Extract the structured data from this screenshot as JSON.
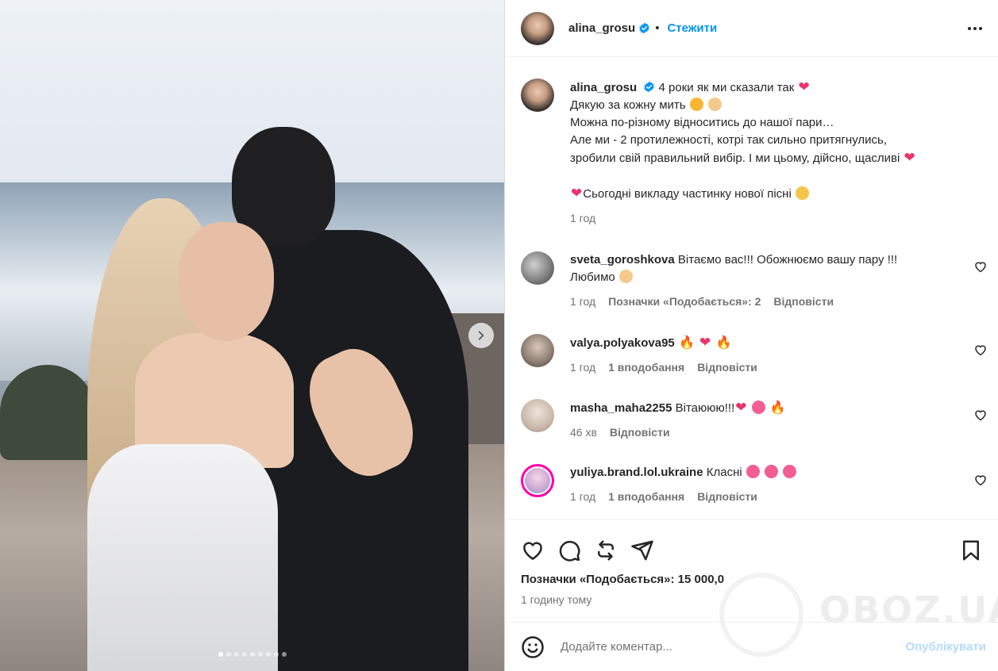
{
  "post": {
    "author": "alina_grosu",
    "follow_label": "Стежити",
    "separator": "•"
  },
  "caption": {
    "username": "alina_grosu",
    "line1": "4 роки як ми сказали так",
    "line2": "Дякую за кожну мить",
    "line3": "Можна по-різному відноситись до нашої пари…",
    "line4": "Але ми - 2 протилежності, котрі так сильно притягнулись,",
    "line5": "зробили свій правильний вибір. І ми цьому, дійсно, щасливі",
    "line6": "Сьогодні викладу частинку нової пісні",
    "time": "1 год"
  },
  "comments": [
    {
      "username": "sveta_goroshkova",
      "text": "Вітаємо вас!!! Обожнюємо вашу пару !!!",
      "text2": "Любимо",
      "time": "1 год",
      "likes": "Позначки «Подобається»: 2",
      "reply": "Відповісти"
    },
    {
      "username": "valya.polyakova95",
      "text": "",
      "time": "1 год",
      "likes": "1 вподобання",
      "reply": "Відповісти"
    },
    {
      "username": "masha_maha2255",
      "text": "Вітаююю!!!",
      "time": "46 хв",
      "reply": "Відповісти"
    },
    {
      "username": "yuliya.brand.lol.ukraine",
      "text": "Класні",
      "time": "1 год",
      "likes": "1 вподобання",
      "reply": "Відповісти"
    }
  ],
  "stats": {
    "likes": "Позначки «Подобається»: 15 000,0",
    "time_ago": "1 годину тому"
  },
  "composer": {
    "placeholder": "Додайте коментар...",
    "publish_label": "Опублікувати"
  },
  "watermark": "OBOZ.UA",
  "carousel": {
    "count": 9,
    "active_index": 0
  },
  "colors": {
    "accent": "#0095f6",
    "verified": "#0095f6",
    "heart": "#e8346a",
    "publish_disabled": "#b3dbff"
  }
}
